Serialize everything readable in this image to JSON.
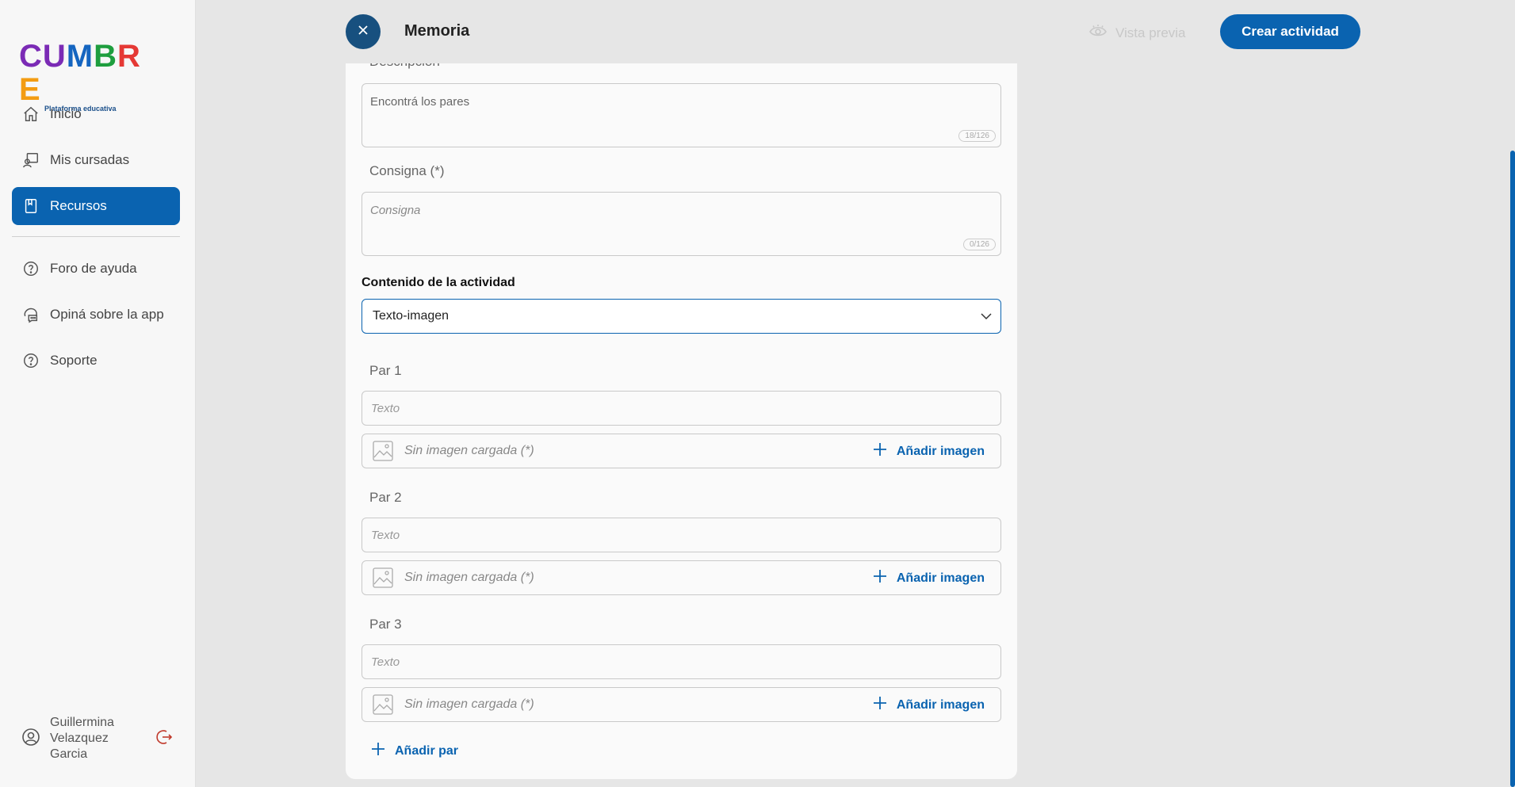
{
  "brand": {
    "logo_letters": [
      "C",
      "U",
      "M",
      "B",
      "R",
      "E"
    ],
    "logo_colors": [
      "#7b2bb5",
      "#7b2bb5",
      "#1565c0",
      "#1e9e3e",
      "#e53935",
      "#f39c12"
    ],
    "tagline": "Plataforma educativa"
  },
  "sidebar": {
    "items": [
      {
        "label": "Inicio",
        "icon": "home-icon"
      },
      {
        "label": "Mis cursadas",
        "icon": "courses-icon"
      },
      {
        "label": "Recursos",
        "icon": "book-icon",
        "active": true
      }
    ],
    "secondary": [
      {
        "label": "Foro de ayuda",
        "icon": "help-circle-icon"
      },
      {
        "label": "Opiná sobre la app",
        "icon": "chat-icon"
      },
      {
        "label": "Soporte",
        "icon": "help-circle-icon"
      }
    ],
    "user": {
      "name": "Guillermina Velazquez Garcia"
    }
  },
  "header": {
    "title": "Memoria",
    "preview_label": "Vista previa",
    "create_label": "Crear actividad"
  },
  "form": {
    "description_label": "Descripción",
    "description_value": "Encontrá los pares",
    "description_counter": "18/126",
    "instruction_label": "Consigna (*)",
    "instruction_placeholder": "Consigna",
    "instruction_counter": "0/126",
    "content_label": "Contenido de la actividad",
    "content_value": "Texto-imagen",
    "pairs": [
      {
        "label": "Par 1",
        "text_placeholder": "Texto",
        "image_status": "Sin imagen cargada (*)",
        "add_image": "Añadir imagen"
      },
      {
        "label": "Par 2",
        "text_placeholder": "Texto",
        "image_status": "Sin imagen cargada (*)",
        "add_image": "Añadir imagen"
      },
      {
        "label": "Par 3",
        "text_placeholder": "Texto",
        "image_status": "Sin imagen cargada (*)",
        "add_image": "Añadir imagen"
      }
    ],
    "add_pair_label": "Añadir par"
  },
  "colors": {
    "primary": "#0a63b0",
    "close_button": "#17507f",
    "sidebar_bg": "#f7f7f7",
    "page_bg": "#e6e6e6"
  }
}
